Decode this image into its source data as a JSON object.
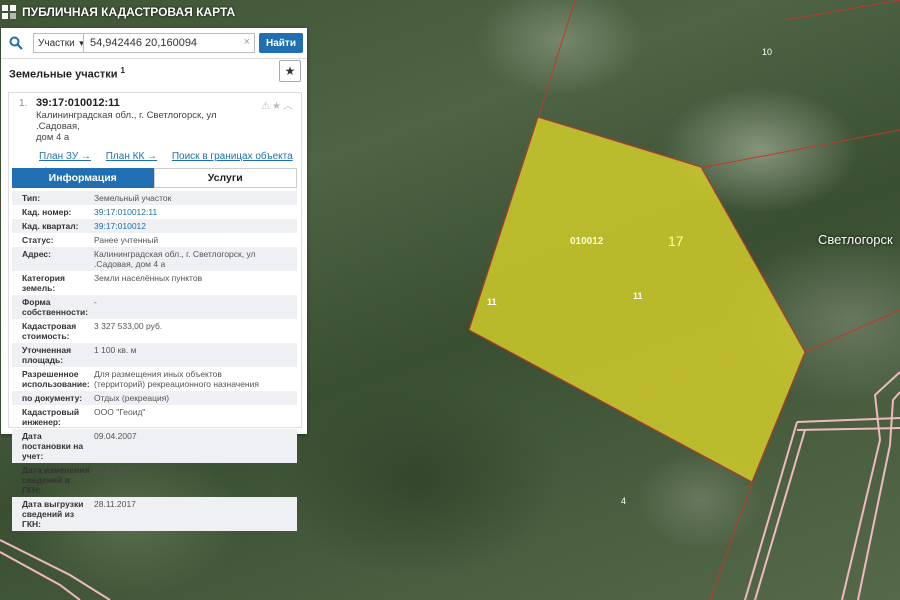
{
  "app": {
    "title": "ПУБЛИЧНАЯ КАДАСТРОВАЯ КАРТА"
  },
  "search": {
    "type_value": "Участки",
    "query_value": "54,942446 20,160094",
    "find_label": "Найти",
    "clear_symbol": "×"
  },
  "results": {
    "title": "Земельные участки",
    "count": "1"
  },
  "card": {
    "index": "1.",
    "cadastral_number": "39:17:010012:11",
    "address_line1": "Калининградская обл., г. Светлогорск, ул .Садовая,",
    "address_line2": "дом 4 а",
    "links": {
      "plan_zu": "План ЗУ →",
      "plan_kk": "План КК →",
      "search_bounds": "Поиск в границах объекта →"
    },
    "tabs": {
      "info": "Информация",
      "services": "Услуги"
    },
    "attributes": [
      {
        "key": "Тип:",
        "value": "Земельный участок"
      },
      {
        "key": "Кад. номер:",
        "value": "39:17:010012:11"
      },
      {
        "key": "Кад. квартал:",
        "value": "39:17:010012"
      },
      {
        "key": "Статус:",
        "value": "Ранее учтенный"
      },
      {
        "key": "Адрес:",
        "value": "Калининградская обл., г. Светлогорск, ул .Садовая, дом 4 а"
      },
      {
        "key": "Категория земель:",
        "value": "Земли населённых пунктов"
      },
      {
        "key": "Форма собственности:",
        "value": "-"
      },
      {
        "key": "Кадастровая стоимость:",
        "value": "3 327 533,00 руб."
      },
      {
        "key": "Уточненная площадь:",
        "value": "1 100 кв. м"
      },
      {
        "key": "Разрешенное использование:",
        "value": "Для размещения иных объектов (территорий) рекреационного назначения"
      },
      {
        "key": "по документу:",
        "value": "Отдых (рекреация)"
      },
      {
        "key": "Кадастровый инженер:",
        "value": "ООО \"Геоид\""
      },
      {
        "key": "Дата постановки на учет:",
        "value": "09.04.2007"
      },
      {
        "key": "Дата изменения сведений в ГКН:",
        "value": "27.11.2017"
      },
      {
        "key": "Дата выгрузки сведений из ГКН:",
        "value": "28.11.2017"
      }
    ]
  },
  "map": {
    "labels": {
      "parcel_block": "010012",
      "block_number": "17",
      "parcel_number_center": "11",
      "parcel_number_left": "11",
      "top_right_number": "10",
      "bottom_number": "4",
      "town": "Светлогорск"
    },
    "colors": {
      "parcel_fill": "#d4d12a",
      "parcel_stroke": "#b03a2e",
      "boundary_pink": "#f0b8c0",
      "accent_blue": "#1f6fb2"
    }
  }
}
